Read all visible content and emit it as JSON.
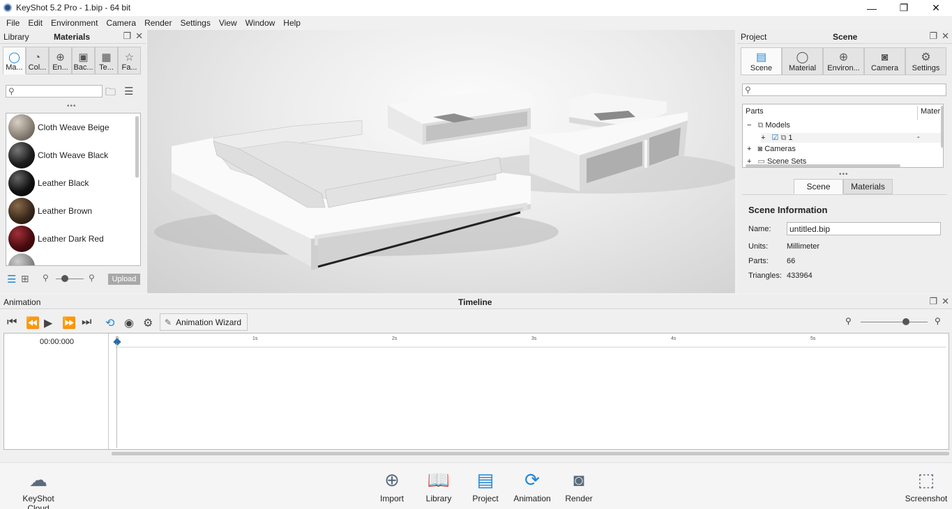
{
  "window": {
    "title": "KeyShot 5.2 Pro  -  1.bip  - 64 bit",
    "controls": [
      "—",
      "❐",
      "✕"
    ]
  },
  "menu": [
    "File",
    "Edit",
    "Environment",
    "Camera",
    "Render",
    "Settings",
    "View",
    "Window",
    "Help"
  ],
  "library": {
    "header_left": "Library",
    "header_title": "Materials",
    "tabs": [
      {
        "label": "Ma...",
        "icon": "material-icon"
      },
      {
        "label": "Col...",
        "icon": "colors-icon"
      },
      {
        "label": "En...",
        "icon": "environment-icon"
      },
      {
        "label": "Bac...",
        "icon": "backplate-icon"
      },
      {
        "label": "Te...",
        "icon": "texture-icon"
      },
      {
        "label": "Fa...",
        "icon": "favorites-icon"
      }
    ],
    "search_placeholder": "",
    "materials": [
      {
        "name": "Cloth Weave Beige",
        "color": "#8c8479"
      },
      {
        "name": "Cloth Weave Black",
        "color": "#1e1e1e"
      },
      {
        "name": "Leather Black",
        "color": "#111111"
      },
      {
        "name": "Leather Brown",
        "color": "#3b2a1c"
      },
      {
        "name": "Leather Dark Red",
        "color": "#4a0c10"
      }
    ],
    "upload_label": "Upload"
  },
  "project": {
    "header_left": "Project",
    "header_title": "Scene",
    "tabs": [
      {
        "label": "Scene",
        "icon": "scene-icon"
      },
      {
        "label": "Material",
        "icon": "material-icon"
      },
      {
        "label": "Environ...",
        "icon": "environment-icon"
      },
      {
        "label": "Camera",
        "icon": "camera-icon"
      },
      {
        "label": "Settings",
        "icon": "gear-icon"
      }
    ],
    "tree": {
      "col_parts": "Parts",
      "col_material": "Mater",
      "rows": [
        {
          "toggle": "−",
          "label": "Models",
          "material": ""
        },
        {
          "toggle": "+",
          "label": "1",
          "material": "-"
        },
        {
          "toggle": "+",
          "label": "Cameras",
          "material": ""
        },
        {
          "toggle": "+",
          "label": "Scene Sets",
          "material": ""
        }
      ]
    },
    "subtabs": [
      "Scene",
      "Materials"
    ],
    "info": {
      "heading": "Scene Information",
      "name_label": "Name:",
      "name_value": "untitled.bip",
      "units_label": "Units:",
      "units_value": "Millimeter",
      "parts_label": "Parts:",
      "parts_value": "66",
      "triangles_label": "Triangles:",
      "triangles_value": "433964"
    }
  },
  "animation": {
    "header_left": "Animation",
    "header_title": "Timeline",
    "wizard_label": "Animation Wizard",
    "time": "00:00:000",
    "ticks": [
      "0",
      "1s",
      "2s",
      "3s",
      "4s",
      "5s"
    ]
  },
  "dock": {
    "cloud": "KeyShot Cloud",
    "buttons": [
      "Import",
      "Library",
      "Project",
      "Animation",
      "Render"
    ],
    "screenshot": "Screenshot"
  },
  "colors": {
    "accent": "#1e86d8",
    "panel_bg": "#eeeeee"
  }
}
